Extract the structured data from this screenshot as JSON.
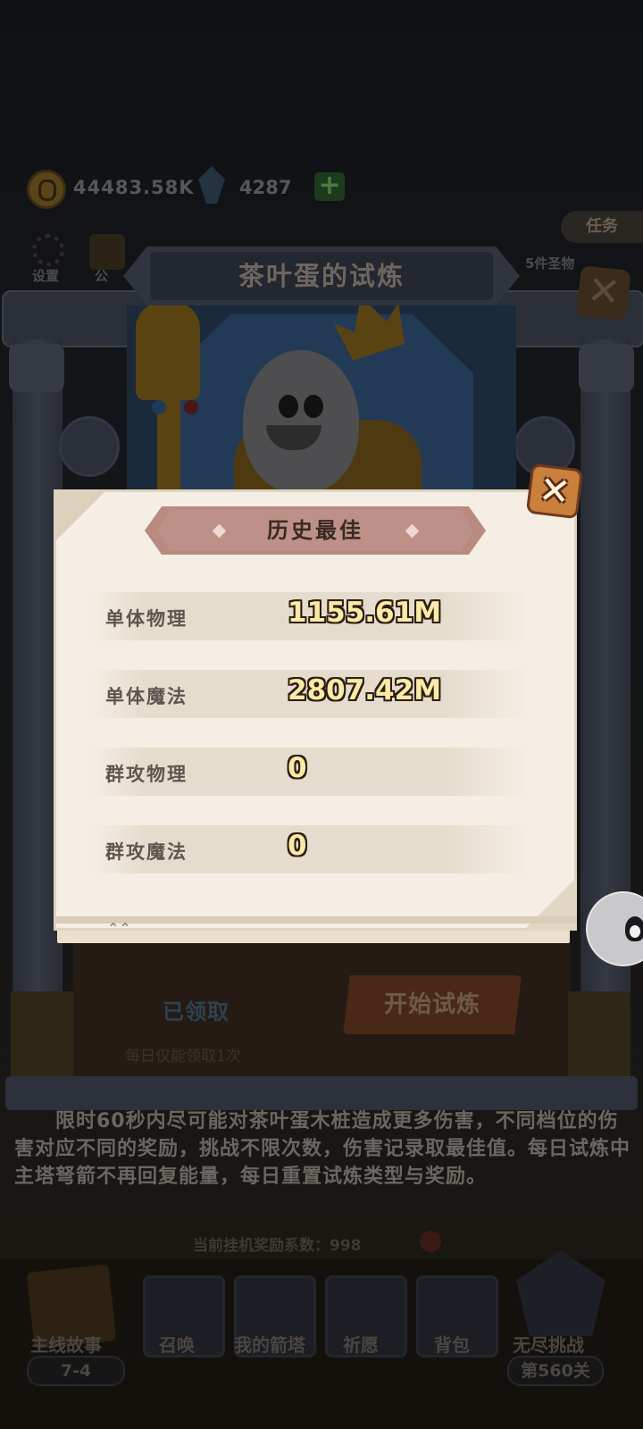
{
  "hud": {
    "gold": "44483.58K",
    "gems": "4287",
    "plus_label": "+",
    "task_tab": "任务",
    "settings_label": "设置",
    "notice_label": "公",
    "set_items_label": "5件圣物"
  },
  "trial": {
    "title": "茶叶蛋的试炼",
    "close_label": "✕",
    "claimed_label": "已领取",
    "start_button": "开始试炼",
    "daily_limit": "每日仅能领取1次",
    "description": "限时60秒内尽可能对茶叶蛋木桩造成更多伤害，不同档位的伤害对应不同的奖励，挑战不限次数，伤害记录取最佳值。每日试炼中主塔弩箭不再回复能量，每日重置试炼类型与奖励。",
    "reward_coefficient": "当前挂机奖励系数：998"
  },
  "history_dialog": {
    "title": "历史最佳",
    "close_label": "✕",
    "stats": [
      {
        "label": "单体物理",
        "value": "1155.61M"
      },
      {
        "label": "单体魔法",
        "value": "2807.42M"
      },
      {
        "label": "群攻物理",
        "value": "0"
      },
      {
        "label": "群攻魔法",
        "value": "0"
      }
    ]
  },
  "bottom_nav": {
    "items": [
      {
        "label": "主线故事",
        "icon": "story-book-icon"
      },
      {
        "label": "召唤",
        "icon": "summon-scroll-icon"
      },
      {
        "label": "我的箭塔",
        "icon": "tower-icon"
      },
      {
        "label": "祈愿",
        "icon": "star-icon"
      },
      {
        "label": "背包",
        "icon": "backpack-icon"
      },
      {
        "label": "无尽挑战",
        "icon": "wings-icon"
      }
    ],
    "stage_left": "7-4",
    "stage_right": "第560关"
  },
  "colors": {
    "dialog_bg": "#f4eee4",
    "banner": "#b88a80",
    "value_fill": "#fbe9a7",
    "close_orange": "#c9803c"
  }
}
